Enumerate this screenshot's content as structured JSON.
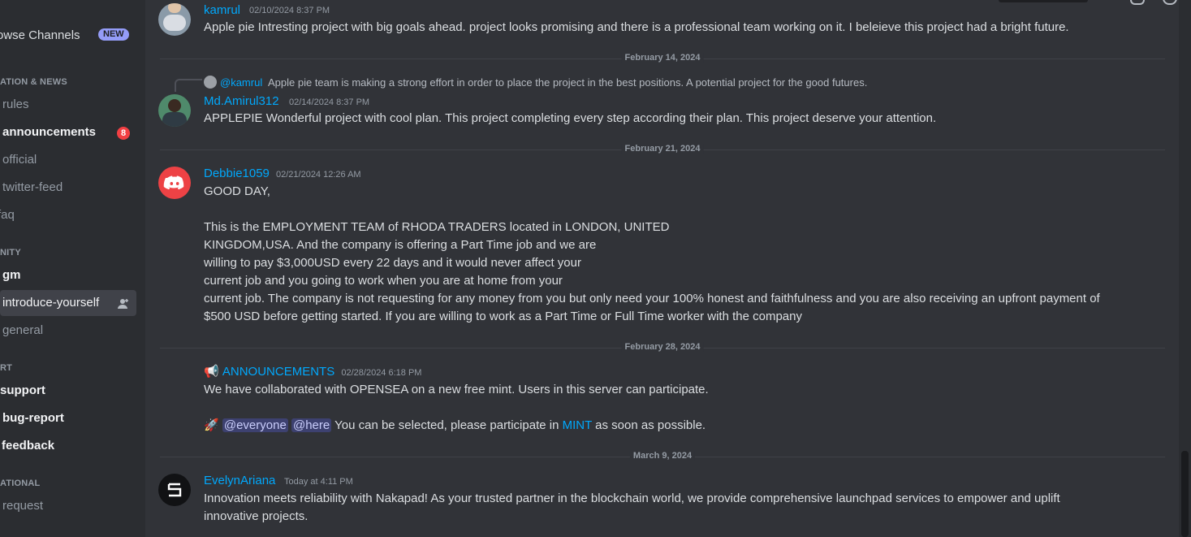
{
  "sidebar": {
    "browse_label": "owse Channels",
    "new_badge": "NEW",
    "categories": {
      "info": "ATION & NEWS",
      "community": "NITY",
      "support": "RT",
      "other": "ATIONAL"
    },
    "channels": {
      "rules": "rules",
      "announcements": "announcements",
      "announcements_mentions": "8",
      "official": "official",
      "twitter": "twitter-feed",
      "faq": "faq",
      "gm": "gm",
      "introduce": "introduce-yourself",
      "general": "general",
      "support": "support",
      "bug": "bug-report",
      "feedback": "feedback",
      "request": "request"
    }
  },
  "chat": {
    "top_message": {
      "author_fragment": "kamrul",
      "timestamp_fragment": "02/10/2024 8:37 PM",
      "text": "Apple pie Intresting project with big goals ahead. project looks promising and there is a professional team working on it. I beleieve this project had a bright future."
    },
    "dividers": [
      "February 14, 2024",
      "February 21, 2024",
      "February 28, 2024",
      "March 9, 2024"
    ],
    "reply": {
      "user": "@kamrul",
      "text": "Apple pie team is making a strong effort in order to place the project in the best positions. A potential project for the good futures."
    },
    "msg_amirul": {
      "author": "Md.Amirul312",
      "timestamp": "02/14/2024 8:37 PM",
      "text": "APPLEPIE Wonderful project with cool plan. This project completing every step according their plan. This project deserve your attention."
    },
    "msg_debbie": {
      "author": "Debbie1059",
      "timestamp": "02/21/2024 12:26 AM",
      "lines": [
        "GOOD DAY,",
        "This is the EMPLOYMENT TEAM of RHODA TRADERS located in LONDON, UNITED",
        "KINGDOM,USA. And the company is offering a Part Time job and we are",
        "willing to pay $3,000USD every 22 days and it would never affect your",
        "current job and you going to work when you are at home from your",
        "current job. The company is not requesting for any money from you but only need your 100% honest and faithfulness and you are also receiving an upfront payment of",
        "$500 USD before getting started. If you are willing to work as a Part Time or Full Time worker with the company"
      ]
    },
    "msg_announce": {
      "emoji": "📢",
      "author": "ANNOUNCEMENTS",
      "timestamp": "02/28/2024 6:18 PM",
      "line1": "We have collaborated with OPENSEA on a new free mint. Users in this server can participate.",
      "emoji2": "🚀",
      "ping1": "@everyone",
      "ping2": "@here",
      "line2_mid": "You can be selected, please participate in",
      "link": "MINT",
      "line2_end": "as soon as possible."
    },
    "msg_evelyn": {
      "author": "EvelynAriana",
      "timestamp": "Today at 4:11 PM",
      "line1": "Innovation meets reliability with Nakapad! As your trusted partner in the blockchain world, we provide comprehensive launchpad services to empower and uplift",
      "line2": "innovative projects."
    }
  },
  "colors": {
    "background": "#313338",
    "sidebar": "#2b2d31",
    "username": "#00a8fc",
    "mention_badge": "#f23f43",
    "new_badge": "#949cf7",
    "discord_avatar": "#ed4245"
  },
  "icons": [
    "add-member-icon",
    "discord-logo-icon",
    "megaphone-icon",
    "rocket-icon",
    "nakapad-logo-icon"
  ]
}
